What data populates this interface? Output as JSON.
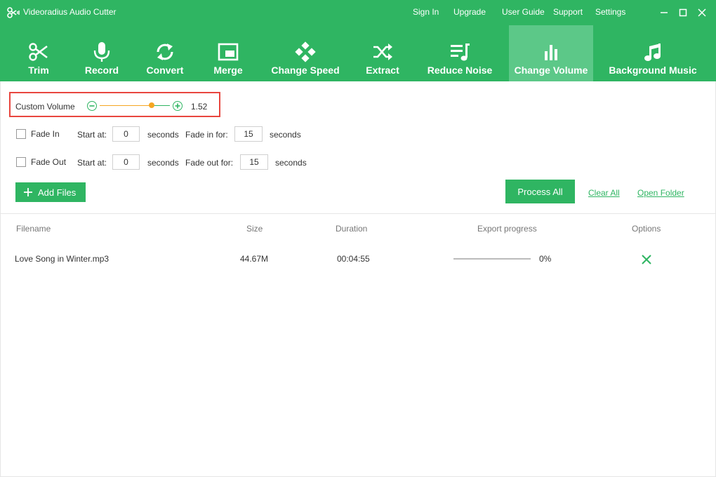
{
  "app": {
    "title": "Videoradius Audio Cutter",
    "menu": [
      "Sign In",
      "Upgrade",
      "User Guide",
      "Support",
      "Settings"
    ]
  },
  "toolbar": {
    "active_index": 7,
    "items": [
      {
        "label": "Trim",
        "icon": "scissors-icon"
      },
      {
        "label": "Record",
        "icon": "microphone-icon"
      },
      {
        "label": "Convert",
        "icon": "convert-arrows-icon"
      },
      {
        "label": "Merge",
        "icon": "merge-window-icon"
      },
      {
        "label": "Change Speed",
        "icon": "gamepad-icon"
      },
      {
        "label": "Extract",
        "icon": "shuffle-icon"
      },
      {
        "label": "Reduce Noise",
        "icon": "reduce-noise-icon"
      },
      {
        "label": "Change Volume",
        "icon": "bar-chart-icon"
      },
      {
        "label": "Background Music",
        "icon": "music-note-icon"
      }
    ]
  },
  "volume": {
    "label": "Custom Volume",
    "value": "1.52",
    "slider_fraction": 0.74
  },
  "fade_in": {
    "label": "Fade In",
    "checked": false,
    "start_label": "Start at:",
    "start_value": "0",
    "unit": "seconds",
    "duration_label": "Fade in for:",
    "duration_value": "15",
    "duration_unit": "seconds"
  },
  "fade_out": {
    "label": "Fade Out",
    "checked": false,
    "start_label": "Start at:",
    "start_value": "0",
    "unit": "seconds",
    "duration_label": "Fade out for:",
    "duration_value": "15",
    "duration_unit": "seconds"
  },
  "actions": {
    "add_files": "Add Files",
    "process_all": "Process All",
    "clear_all": "Clear All",
    "open_folder": "Open Folder"
  },
  "table": {
    "columns": [
      "Filename",
      "Size",
      "Duration",
      "Export progress",
      "Options"
    ],
    "rows": [
      {
        "filename": "Love Song in Winter.mp3",
        "size": "44.67M",
        "duration": "00:04:55",
        "progress": "0%",
        "progress_fraction": 0
      }
    ]
  },
  "colors": {
    "accent": "#2fb562",
    "slider_active": "#f5a623",
    "highlight": "#e8463f"
  }
}
